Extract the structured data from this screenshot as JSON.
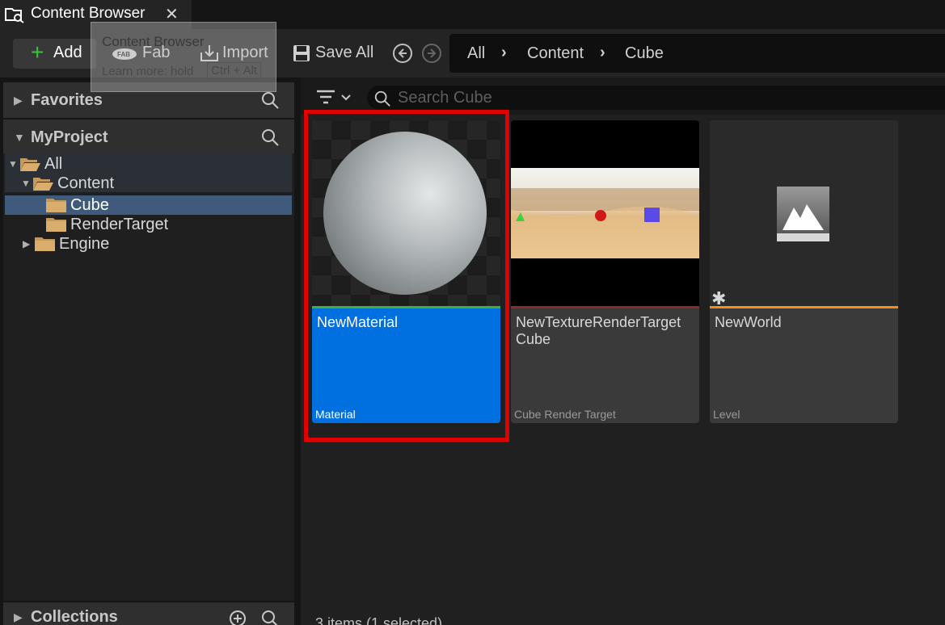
{
  "tab": {
    "title": "Content Browser",
    "close": "✕"
  },
  "toolbar": {
    "add_label": "Add",
    "fab_label": "Fab",
    "import_label": "Import",
    "save_all_label": "Save All"
  },
  "tooltip": {
    "title": "Content Browser",
    "learn_more": "Learn more: hold",
    "shortcut": "Ctrl + Alt"
  },
  "breadcrumb": [
    "All",
    "Content",
    "Cube"
  ],
  "sidebar": {
    "favorites_label": "Favorites",
    "project_label": "MyProject",
    "tree": [
      {
        "label": "All",
        "expanded": true
      },
      {
        "label": "Content",
        "expanded": true
      },
      {
        "label": "Cube",
        "selected": true
      },
      {
        "label": "RenderTarget"
      },
      {
        "label": "Engine",
        "expanded": false
      }
    ],
    "collections_label": "Collections"
  },
  "search": {
    "placeholder": "Search Cube"
  },
  "assets": [
    {
      "name": "NewMaterial",
      "type": "Material",
      "selected": true,
      "bar_color": "#3cb043"
    },
    {
      "name": "NewTextureRenderTarget Cube",
      "type": "Cube Render Target",
      "selected": false,
      "bar_color": "#8b2a2a"
    },
    {
      "name": "NewWorld",
      "type": "Level",
      "selected": false,
      "bar_color": "#f0901a"
    }
  ],
  "status": "3 items (1 selected)",
  "colors": {
    "accent": "#0070e0",
    "highlight": "#e00000",
    "add_icon": "#3fbf3f"
  }
}
